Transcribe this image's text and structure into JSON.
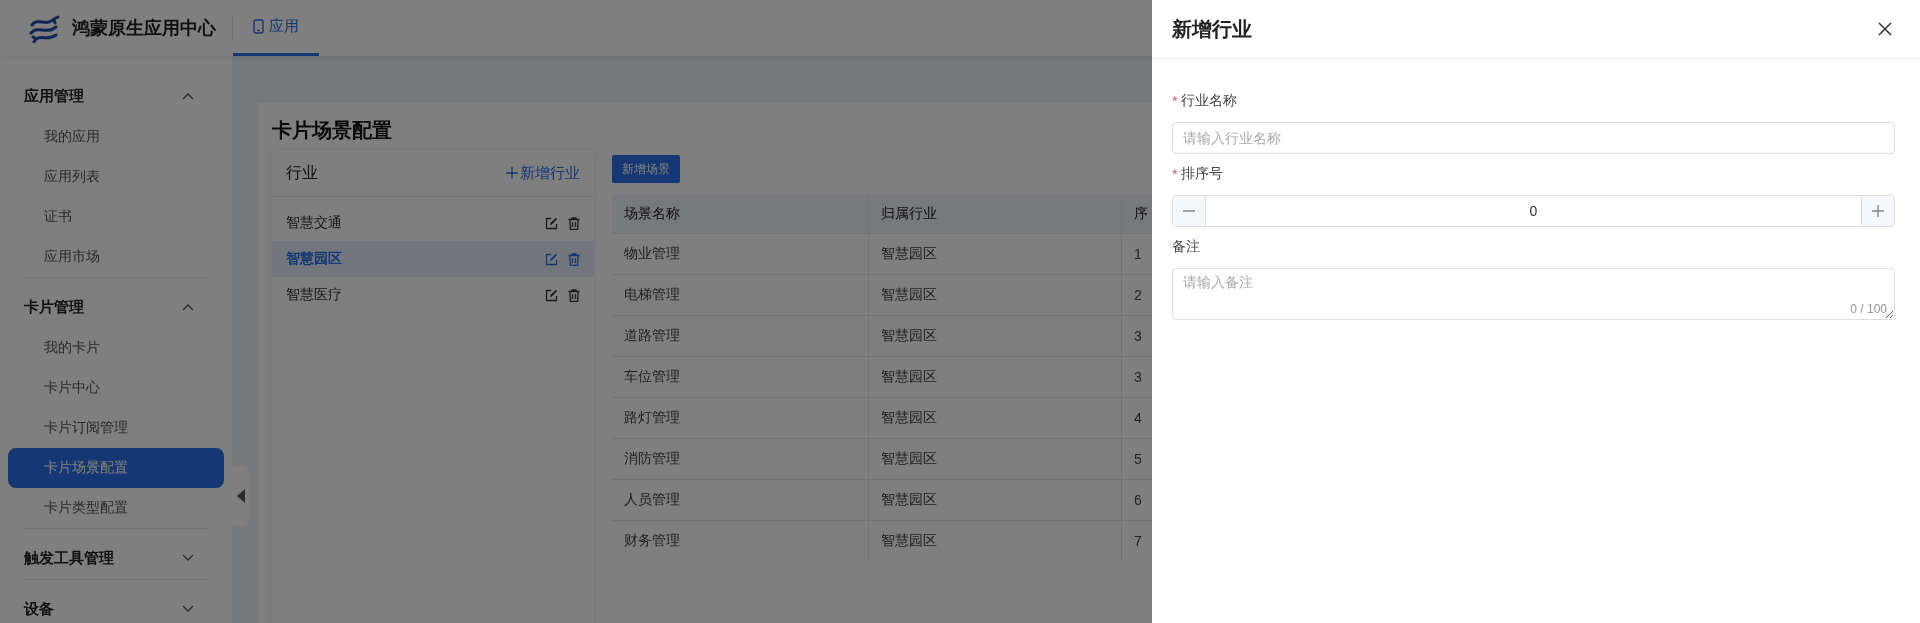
{
  "header": {
    "brand": "鸿蒙原生应用中心",
    "tabs": [
      {
        "label": "应用",
        "selected": true
      }
    ]
  },
  "sidebar": {
    "groups": [
      {
        "label": "应用管理",
        "expanded": true,
        "items": [
          {
            "label": "我的应用",
            "selected": false
          },
          {
            "label": "应用列表",
            "selected": false
          },
          {
            "label": "证书",
            "selected": false
          },
          {
            "label": "应用市场",
            "selected": false
          }
        ]
      },
      {
        "label": "卡片管理",
        "expanded": true,
        "items": [
          {
            "label": "我的卡片",
            "selected": false
          },
          {
            "label": "卡片中心",
            "selected": false
          },
          {
            "label": "卡片订阅管理",
            "selected": false
          },
          {
            "label": "卡片场景配置",
            "selected": true
          },
          {
            "label": "卡片类型配置",
            "selected": false
          }
        ]
      },
      {
        "label": "触发工具管理",
        "expanded": false
      },
      {
        "label": "设备",
        "expanded": false
      }
    ]
  },
  "page": {
    "title": "卡片场景配置"
  },
  "industry_panel": {
    "title": "行业",
    "add_link": "新增行业",
    "items": [
      {
        "label": "智慧交通",
        "selected": false
      },
      {
        "label": "智慧园区",
        "selected": true
      },
      {
        "label": "智慧医疗",
        "selected": false
      }
    ]
  },
  "scene_table": {
    "add_button": "新增场景",
    "columns": [
      "场景名称",
      "归属行业",
      "序"
    ],
    "rows": [
      [
        "物业管理",
        "智慧园区",
        "1"
      ],
      [
        "电梯管理",
        "智慧园区",
        "2"
      ],
      [
        "道路管理",
        "智慧园区",
        "3"
      ],
      [
        "车位管理",
        "智慧园区",
        "3"
      ],
      [
        "路灯管理",
        "智慧园区",
        "4"
      ],
      [
        "消防管理",
        "智慧园区",
        "5"
      ],
      [
        "人员管理",
        "智慧园区",
        "6"
      ],
      [
        "财务管理",
        "智慧园区",
        "7"
      ]
    ]
  },
  "drawer": {
    "title": "新增行业",
    "fields": [
      {
        "kind": "text",
        "label": "行业名称",
        "required_mark": "*",
        "placeholder": "请输入行业名称"
      },
      {
        "kind": "number",
        "label": "排序号",
        "required_mark": "*",
        "value": "0"
      },
      {
        "kind": "textarea",
        "label": "备注",
        "placeholder": "请输入备注",
        "counter": "0 / 100"
      }
    ]
  }
}
